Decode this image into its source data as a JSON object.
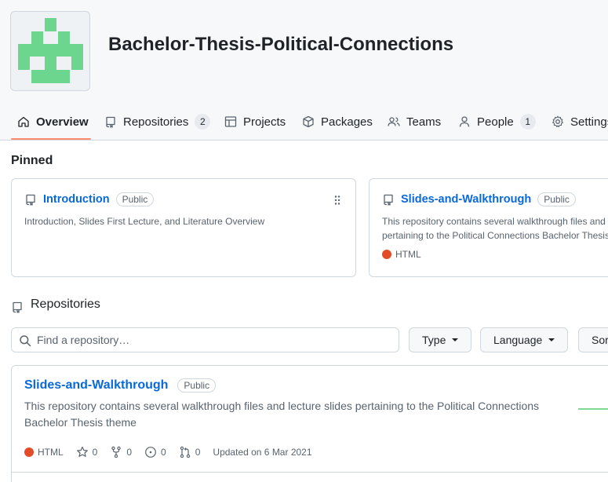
{
  "org": {
    "name": "Bachelor-Thesis-Political-Connections"
  },
  "nav": {
    "items": [
      {
        "label": "Overview",
        "icon": "home-icon"
      },
      {
        "label": "Repositories",
        "icon": "repo-icon",
        "count": "2"
      },
      {
        "label": "Projects",
        "icon": "table-icon"
      },
      {
        "label": "Packages",
        "icon": "package-icon"
      },
      {
        "label": "Teams",
        "icon": "people-icon"
      },
      {
        "label": "People",
        "icon": "person-icon",
        "count": "1"
      },
      {
        "label": "Settings",
        "icon": "gear-icon"
      }
    ]
  },
  "pinned": {
    "title": "Pinned",
    "cards": [
      {
        "name": "Introduction",
        "visibility": "Public",
        "description": "Introduction, Slides First Lecture, and Literature Overview"
      },
      {
        "name": "Slides-and-Walkthrough",
        "visibility": "Public",
        "description_line1": "This repository contains several walkthrough files and",
        "description_line2": "pertaining to the Political Connections Bachelor Thesis",
        "language": "HTML"
      }
    ]
  },
  "repositories": {
    "title": "Repositories",
    "search_placeholder": "Find a repository…",
    "filters": {
      "type": "Type",
      "language": "Language",
      "sort": "Sort"
    },
    "items": [
      {
        "name": "Slides-and-Walkthrough",
        "visibility": "Public",
        "description": "This repository contains several walkthrough files and lecture slides pertaining to the Political Connections Bachelor Thesis theme",
        "language": "HTML",
        "stars": "0",
        "forks": "0",
        "issues": "0",
        "pull_requests": "0",
        "updated": "Updated on 6 Mar 2021"
      }
    ]
  },
  "colors": {
    "html_language": "#e34c26",
    "avatar_green": "#6cd68f",
    "nav_underline": "#fd8c73",
    "link": "#0969da"
  }
}
